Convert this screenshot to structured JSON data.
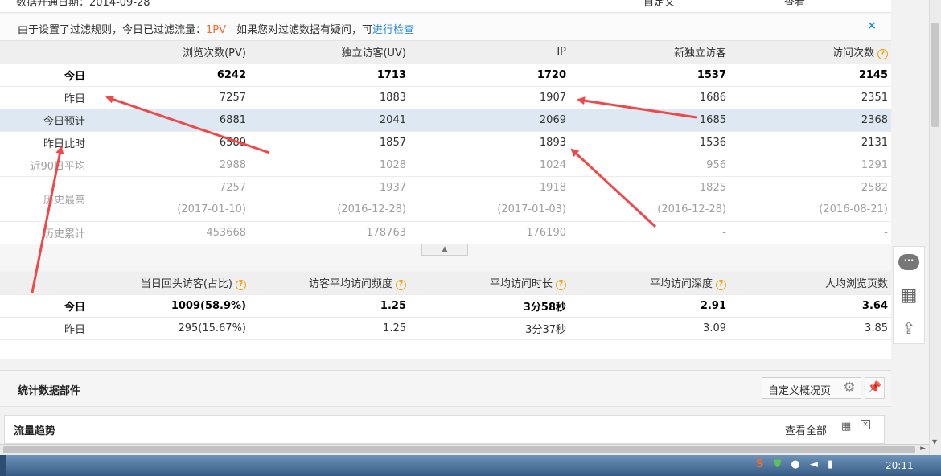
{
  "top_strip": {
    "left_text": "数据开通日期：2014-09-28",
    "right_text": "自定义",
    "right_text2": "查看"
  },
  "notice": {
    "prefix": "由于设置了过滤规则，今日已过滤流量：",
    "filtered": "1PV",
    "middle": "　如果您对过滤数据有疑问，可",
    "link": "进行检查",
    "close_icon": "×"
  },
  "table1": {
    "headers": [
      "",
      "浏览次数(PV)",
      "独立访客(UV)",
      "IP",
      "新独立访客",
      "访问次数"
    ],
    "rows": [
      {
        "label": "今日",
        "pv": "6242",
        "uv": "1713",
        "ip": "1720",
        "new_uv": "1537",
        "visits": "2145"
      },
      {
        "label": "昨日",
        "pv": "7257",
        "uv": "1883",
        "ip": "1907",
        "new_uv": "1686",
        "visits": "2351"
      },
      {
        "label": "今日预计",
        "pv": "6881",
        "uv": "2041",
        "ip": "2069",
        "new_uv": "1685",
        "visits": "2368"
      },
      {
        "label": "昨日此时",
        "pv": "6589",
        "uv": "1857",
        "ip": "1893",
        "new_uv": "1536",
        "visits": "2131"
      },
      {
        "label": "近90日平均",
        "pv": "2988",
        "uv": "1028",
        "ip": "1024",
        "new_uv": "956",
        "visits": "1291"
      },
      {
        "label": "历史最高",
        "pv": "7257",
        "uv": "1937",
        "ip": "1918",
        "new_uv": "1825",
        "visits": "2582"
      },
      {
        "label": "",
        "pv": "(2017-01-10)",
        "uv": "(2016-12-28)",
        "ip": "(2017-01-03)",
        "new_uv": "(2016-12-28)",
        "visits": "(2016-08-21)"
      },
      {
        "label": "历史累计",
        "pv": "453668",
        "uv": "178763",
        "ip": "176190",
        "new_uv": "-",
        "visits": "-"
      }
    ]
  },
  "table2": {
    "headers": [
      "",
      "当日回头访客(占比)",
      "访客平均访问频度",
      "平均访问时长",
      "平均访问深度",
      "人均浏览页数"
    ],
    "rows": [
      {
        "label": "今日",
        "returning": "1009(58.9%)",
        "freq": "1.25",
        "duration": "3分58秒",
        "depth": "2.91",
        "pages": "3.64"
      },
      {
        "label": "昨日",
        "returning": "295(15.67%)",
        "freq": "1.25",
        "duration": "3分37秒",
        "depth": "3.09",
        "pages": "3.85"
      }
    ]
  },
  "section": {
    "title": "统计数据部件",
    "customize_button": "自定义概况页"
  },
  "trend": {
    "title": "流量趋势",
    "view_all": "查看全部"
  },
  "taskbar": {
    "clock": "20:11"
  },
  "colors": {
    "accent_link": "#2a8ad4",
    "highlight": "#f26b2a",
    "annotation_arrow": "#f04848",
    "selected_row": "#dde8f3"
  }
}
